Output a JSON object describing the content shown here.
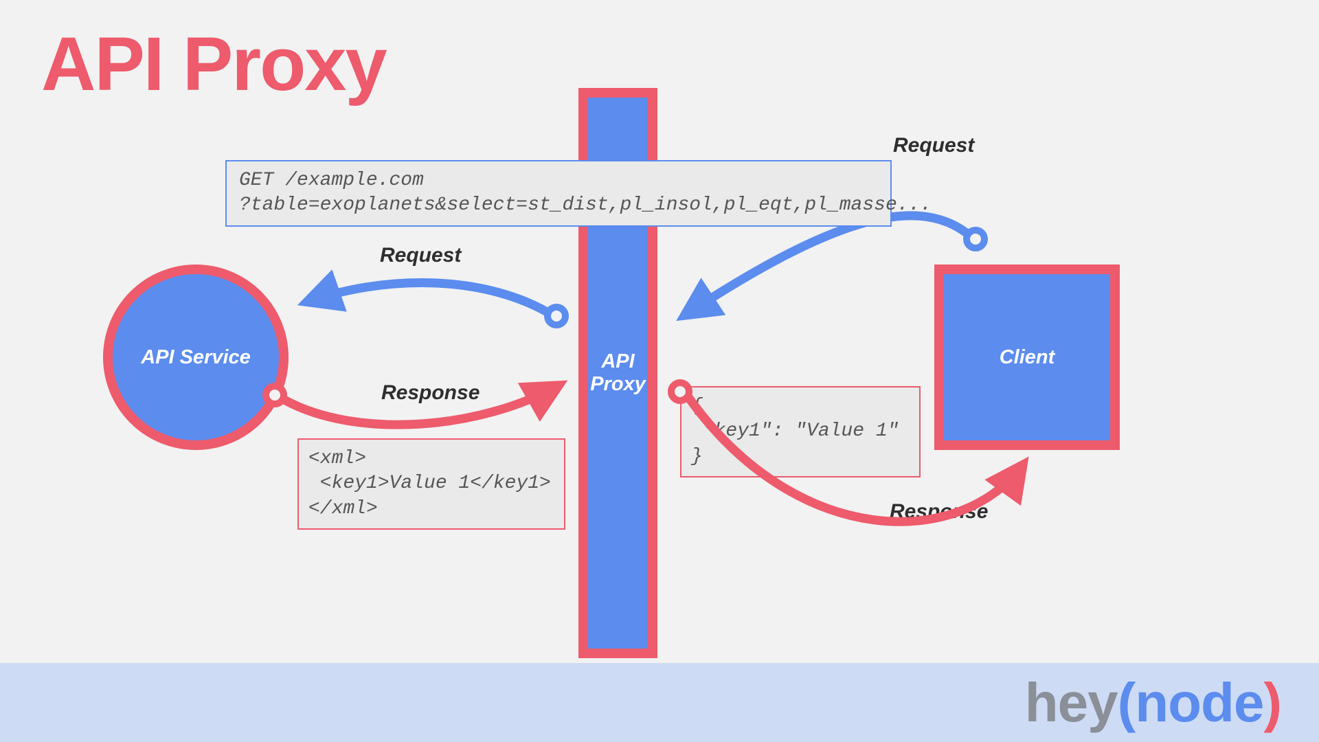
{
  "title": "API Proxy",
  "nodes": {
    "api_service": "API Service",
    "proxy": "API\nProxy",
    "client": "Client"
  },
  "labels": {
    "request_left": "Request",
    "response_left": "Response",
    "request_right": "Request",
    "response_right": "Response"
  },
  "code": {
    "get_request": "GET /example.com\n?table=exoplanets&select=st_dist,pl_insol,pl_eqt,pl_masse...",
    "xml_response": "<xml>\n <key1>Value 1</key1>\n</xml>",
    "json_response": "{\n \"key1\": \"Value 1\"\n}"
  },
  "footer_logo": {
    "part1": "hey",
    "paren_open": "(",
    "part2": "node",
    "paren_close": ")"
  },
  "colors": {
    "blue": "#5b8cee",
    "red": "#ed5b6c",
    "bg": "#f2f2f2",
    "footer": "#cddbf5",
    "text_dark": "#2e2e2e",
    "code_bg": "#eaeaea",
    "code_text": "#555555"
  }
}
